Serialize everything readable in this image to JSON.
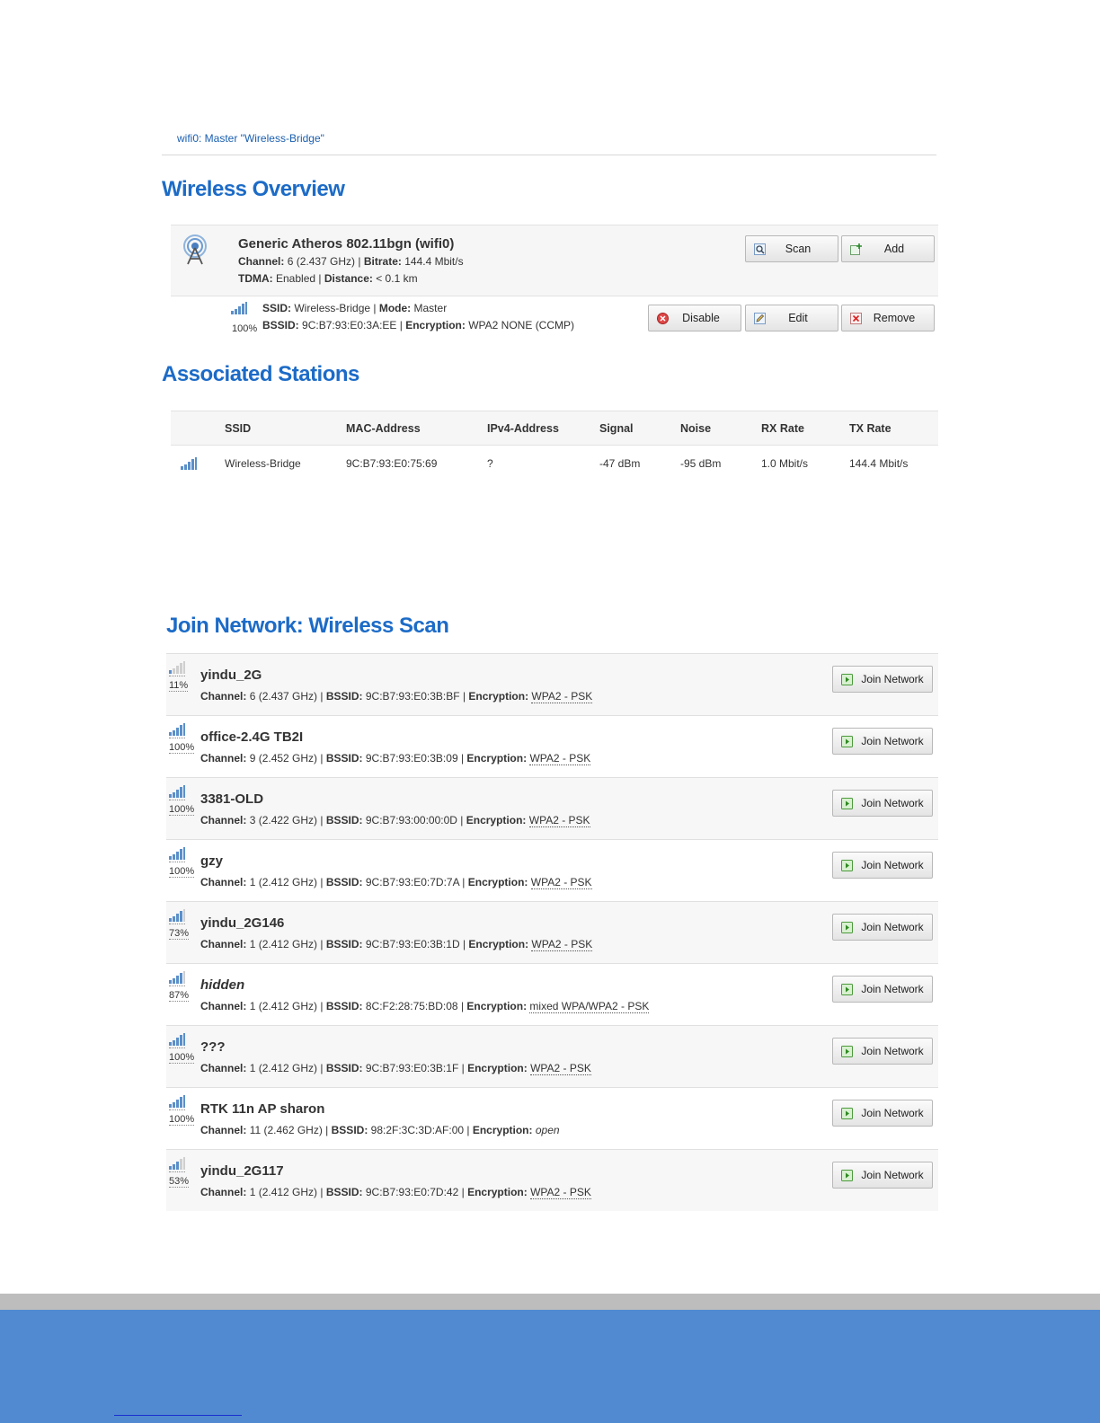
{
  "tab": {
    "label": "wifi0: Master \"Wireless-Bridge\""
  },
  "overview": {
    "title": "Wireless Overview",
    "device": {
      "name": "Generic Atheros 802.11bgn (wifi0)",
      "channel_label": "Channel:",
      "channel_value": "6 (2.437 GHz)",
      "bitrate_label": "Bitrate:",
      "bitrate_value": "144.4 Mbit/s",
      "tdma_label": "TDMA:",
      "tdma_value": "Enabled",
      "distance_label": "Distance:",
      "distance_value": "< 0.1 km",
      "scan_label": "Scan",
      "add_label": "Add"
    },
    "network": {
      "signal_pct": "100%",
      "signal_level": 1.0,
      "ssid_label": "SSID:",
      "ssid_value": "Wireless-Bridge",
      "mode_label": "Mode:",
      "mode_value": "Master",
      "bssid_label": "BSSID:",
      "bssid_value": "9C:B7:93:E0:3A:EE",
      "enc_label": "Encryption:",
      "enc_value": "WPA2 NONE (CCMP)",
      "disable_label": "Disable",
      "edit_label": "Edit",
      "remove_label": "Remove"
    }
  },
  "stations": {
    "title": "Associated Stations",
    "headers": [
      "SSID",
      "MAC-Address",
      "IPv4-Address",
      "Signal",
      "Noise",
      "RX Rate",
      "TX Rate"
    ],
    "rows": [
      [
        "Wireless-Bridge",
        "9C:B7:93:E0:75:69",
        "?",
        "-47 dBm",
        "-95 dBm",
        "1.0 Mbit/s",
        "144.4 Mbit/s"
      ]
    ]
  },
  "scan": {
    "title": "Join Network: Wireless Scan",
    "join_label": "Join Network",
    "channel_label": "Channel:",
    "bssid_label": "BSSID:",
    "enc_label": "Encryption:",
    "networks": [
      {
        "ssid": "yindu_2G",
        "pct": "11%",
        "level": 0.11,
        "channel": "6 (2.437 GHz)",
        "bssid": "9C:B7:93:E0:3B:BF",
        "enc": "WPA2 - PSK"
      },
      {
        "ssid": "office-2.4G TB2I",
        "pct": "100%",
        "level": 1.0,
        "channel": "9 (2.452 GHz)",
        "bssid": "9C:B7:93:E0:3B:09",
        "enc": "WPA2 - PSK"
      },
      {
        "ssid": "3381-OLD",
        "pct": "100%",
        "level": 1.0,
        "channel": "3 (2.422 GHz)",
        "bssid": "9C:B7:93:00:00:0D",
        "enc": "WPA2 - PSK"
      },
      {
        "ssid": "gzy",
        "pct": "100%",
        "level": 1.0,
        "channel": "1 (2.412 GHz)",
        "bssid": "9C:B7:93:E0:7D:7A",
        "enc": "WPA2 - PSK"
      },
      {
        "ssid": "yindu_2G146",
        "pct": "73%",
        "level": 0.73,
        "channel": "1 (2.412 GHz)",
        "bssid": "9C:B7:93:E0:3B:1D",
        "enc": "WPA2 - PSK"
      },
      {
        "ssid": "hidden",
        "pct": "87%",
        "level": 0.87,
        "channel": "1 (2.412 GHz)",
        "bssid": "8C:F2:28:75:BD:08",
        "enc": "mixed WPA/WPA2 - PSK",
        "italic_name": true
      },
      {
        "ssid": "???",
        "pct": "100%",
        "level": 1.0,
        "channel": "1 (2.412 GHz)",
        "bssid": "9C:B7:93:E0:3B:1F",
        "enc": "WPA2 - PSK"
      },
      {
        "ssid": "RTK 11n AP sharon",
        "pct": "100%",
        "level": 1.0,
        "channel": "11 (2.462 GHz)",
        "bssid": "98:2F:3C:3D:AF:00",
        "enc": "open",
        "italic_enc": true
      },
      {
        "ssid": "yindu_2G117",
        "pct": "53%",
        "level": 0.53,
        "channel": "1 (2.412 GHz)",
        "bssid": "9C:B7:93:E0:7D:42",
        "enc": "WPA2 - PSK"
      }
    ]
  },
  "colors": {
    "heading": "#1c6bc7",
    "signal_bar": "#5b8fc9",
    "signal_bar_off": "#cfcfcf",
    "footer_grey": "#bdbdbd",
    "footer_blue": "#518ad0"
  }
}
